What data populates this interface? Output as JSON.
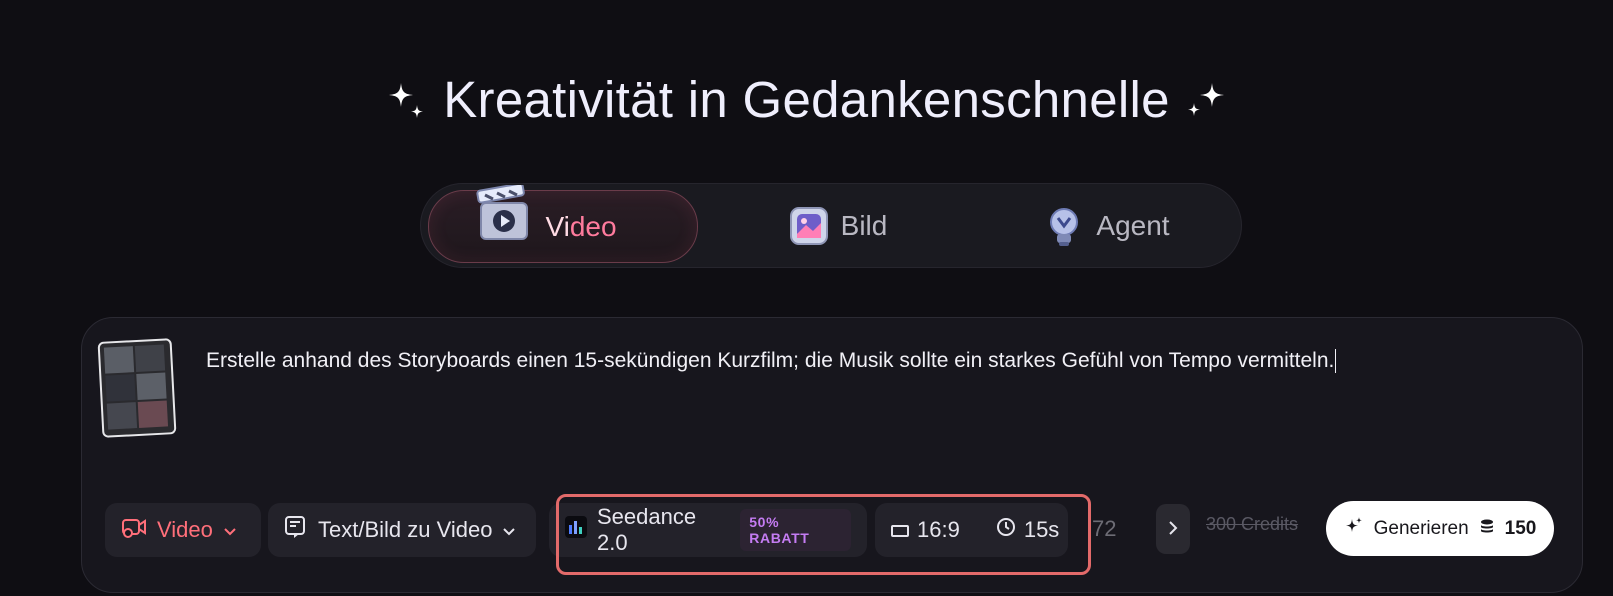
{
  "headline": {
    "text": "Kreativität in Gedankenschnelle",
    "left_icon": "sparkles-icon",
    "right_icon": "sparkles-icon"
  },
  "mode_tabs": [
    {
      "label": "Video",
      "icon": "clapperboard-icon",
      "active": true
    },
    {
      "label": "Bild",
      "icon": "image-icon",
      "active": false
    },
    {
      "label": "Agent",
      "icon": "lightbulb-icon",
      "active": false
    }
  ],
  "prompt": {
    "attachment_icon": "storyboard-thumbnail",
    "text": "Erstelle anhand des Storyboards einen 15-sekündigen Kurzfilm; die Musik sollte ein starkes Gefühl von Tempo vermitteln."
  },
  "toolbar": {
    "type_select": {
      "label": "Video",
      "icon": "video-icon"
    },
    "mode_select": {
      "label": "Text/Bild zu Video",
      "icon": "text-image-icon"
    },
    "model": {
      "label": "Seedance 2.0",
      "badge": "50% RABATT",
      "icon": "seedance-logo-icon"
    },
    "aspect_ratio": {
      "label": "16:9",
      "icon": "rectangle-icon"
    },
    "duration": {
      "label": "15s",
      "icon": "clock-icon"
    },
    "resolution_partial": "72",
    "scroll_icon": "chevron-right-icon",
    "old_credits": "300 Credits",
    "generate": {
      "label": "Generieren",
      "cost": "150",
      "icon": "sparkle-icon",
      "coin_icon": "coin-stack-icon"
    }
  },
  "colors": {
    "background": "#0f0e13",
    "accent_pink": "#ff7b9d",
    "badge_purple": "#c57cf3",
    "highlight_red": "#e36a6a"
  }
}
